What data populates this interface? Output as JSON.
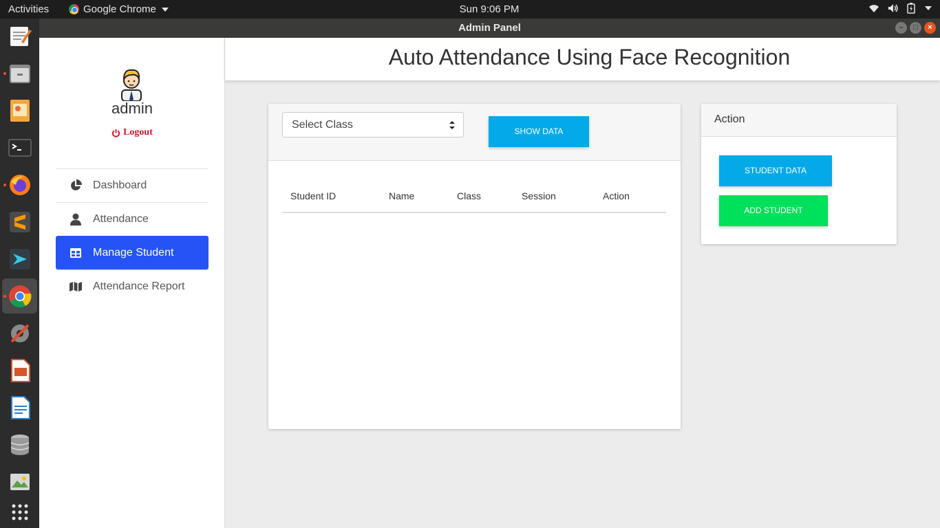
{
  "topbar": {
    "activities": "Activities",
    "app_name": "Google Chrome",
    "clock": "Sun  9:06 PM"
  },
  "window": {
    "title": "Admin Panel"
  },
  "sidebar": {
    "username": "admin",
    "logout": "Logout",
    "items": [
      {
        "label": "Dashboard",
        "icon": "pie-chart-icon",
        "active": false
      },
      {
        "label": "Attendance",
        "icon": "user-icon",
        "active": false
      },
      {
        "label": "Manage Student",
        "icon": "table-icon",
        "active": true
      },
      {
        "label": "Attendance Report",
        "icon": "map-icon",
        "active": false
      }
    ]
  },
  "header": {
    "title": "Auto Attendance Using Face Recognition"
  },
  "main": {
    "select_value": "Select Class",
    "show_button": "SHOW DATA",
    "columns": [
      "Student ID",
      "Name",
      "Class",
      "Session",
      "Action"
    ]
  },
  "action_panel": {
    "title": "Action",
    "student_data_button": "STUDENT DATA",
    "add_student_button": "ADD STUDENT"
  },
  "colors": {
    "active_nav": "#2553f5",
    "primary_button": "#03a9e9",
    "success_button": "#00e15b",
    "logout": "#e0102d"
  }
}
